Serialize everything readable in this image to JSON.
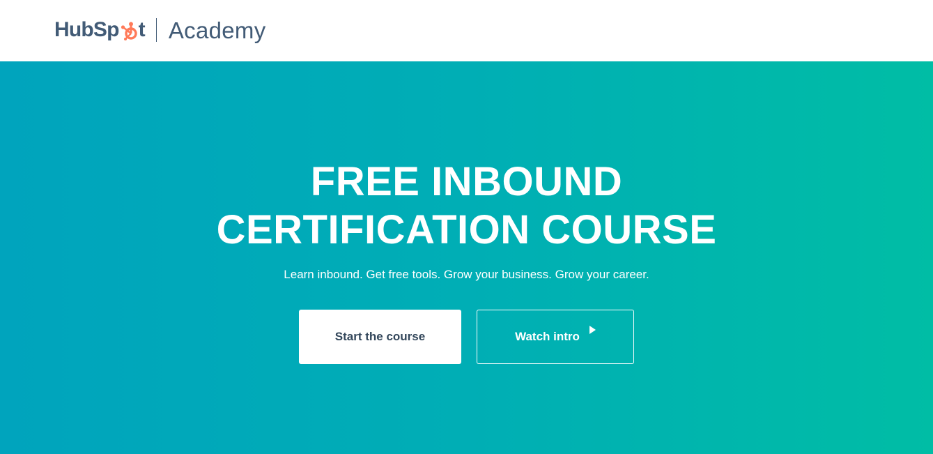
{
  "header": {
    "brand": "HubSpot",
    "brand_prefix": "HubSp",
    "brand_suffix": "t",
    "product": "Academy"
  },
  "hero": {
    "title_line1": "FREE INBOUND",
    "title_line2": "CERTIFICATION COURSE",
    "subtitle": "Learn inbound. Get free tools. Grow your business. Grow your career.",
    "primary_button": "Start the course",
    "secondary_button": "Watch intro"
  },
  "icons": {
    "sprocket": "hubspot-sprocket-icon",
    "play": "play-icon"
  },
  "colors": {
    "brand_text": "#425b76",
    "sprocket": "#ff7a59",
    "hero_gradient_start": "#00a4bd",
    "hero_gradient_end": "#00bda5",
    "primary_button_text": "#33475b",
    "white": "#ffffff"
  }
}
